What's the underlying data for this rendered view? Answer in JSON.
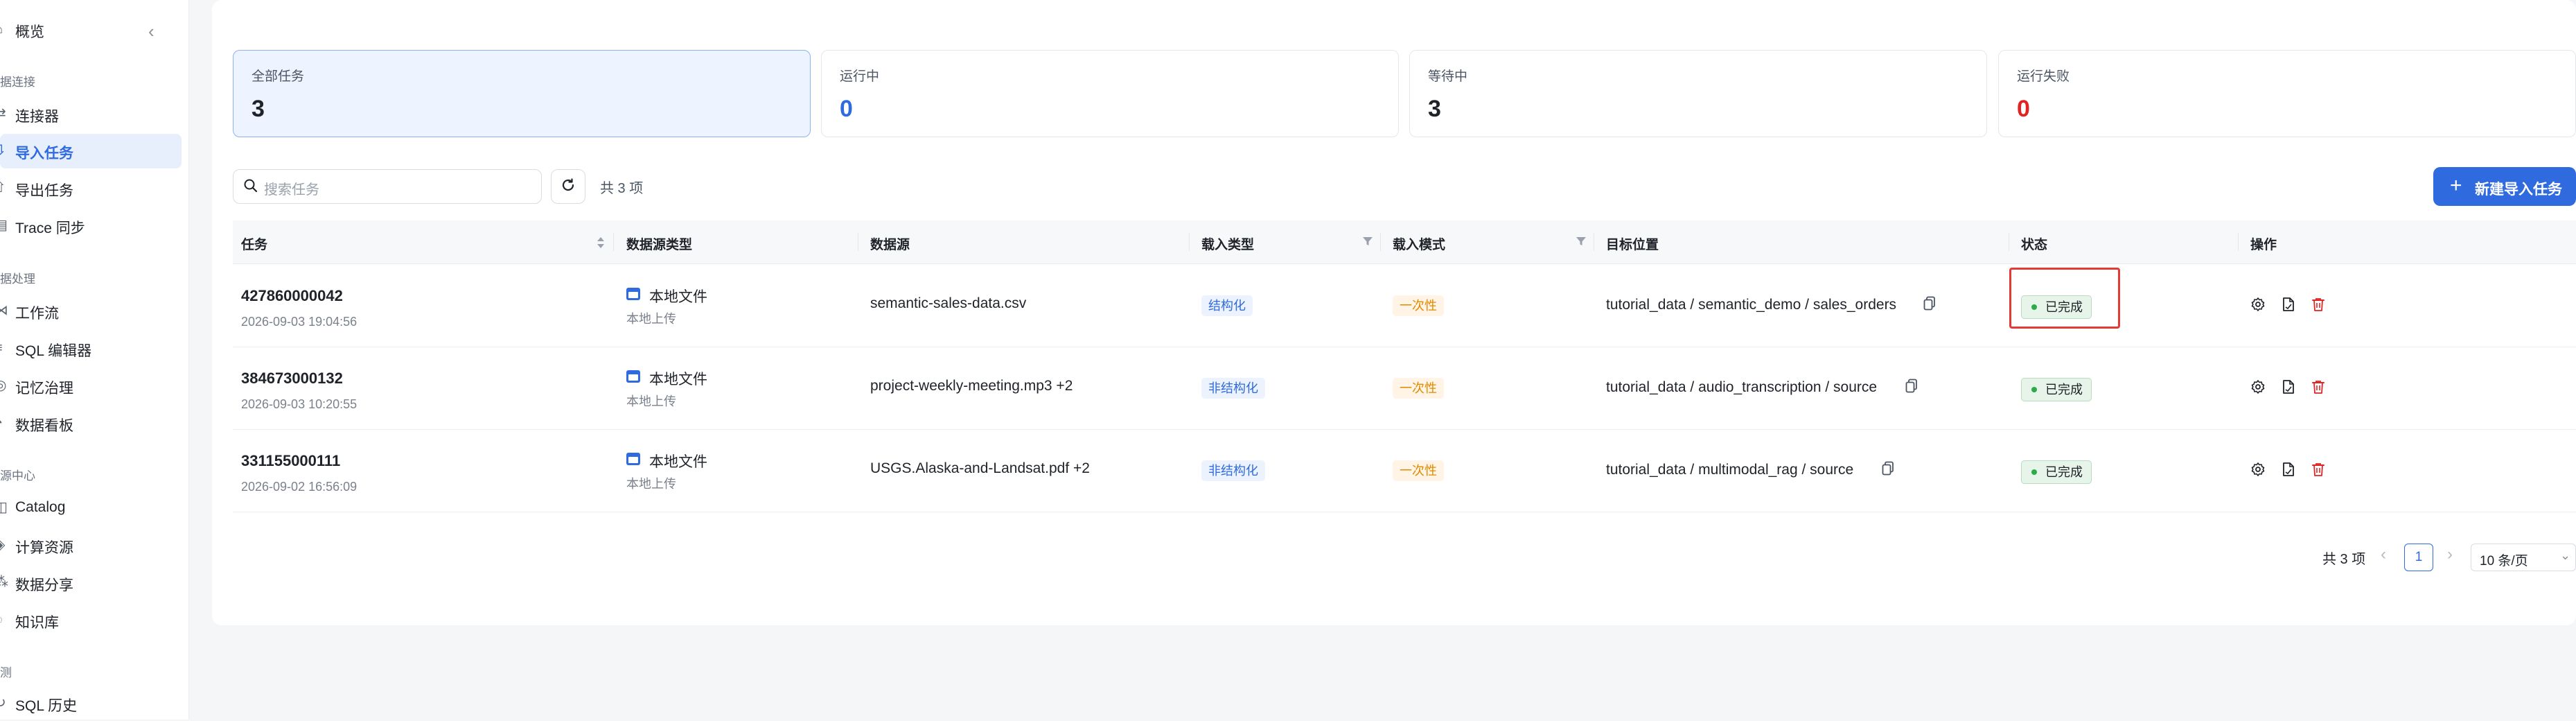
{
  "sidebar": {
    "overview": "概览",
    "groups": [
      "据连接",
      "据处理",
      "源中心",
      "测"
    ],
    "items": [
      {
        "label": "连接器",
        "icon": "connector-icon"
      },
      {
        "label": "导入任务",
        "icon": "import-icon",
        "active": true
      },
      {
        "label": "导出任务",
        "icon": "export-icon"
      },
      {
        "label": "Trace 同步",
        "icon": "trace-icon"
      },
      {
        "label": "工作流",
        "icon": "workflow-icon"
      },
      {
        "label": "SQL 编辑器",
        "icon": "sql-editor-icon"
      },
      {
        "label": "记忆治理",
        "icon": "memory-icon"
      },
      {
        "label": "数据看板",
        "icon": "dashboard-icon"
      },
      {
        "label": "Catalog",
        "icon": "catalog-icon"
      },
      {
        "label": "计算资源",
        "icon": "compute-icon"
      },
      {
        "label": "数据分享",
        "icon": "share-icon"
      },
      {
        "label": "知识库",
        "icon": "knowledge-icon"
      },
      {
        "label": "SQL 历史",
        "icon": "history-icon"
      }
    ]
  },
  "stats": [
    {
      "label": "全部任务",
      "value": "3",
      "color": "#1f2329"
    },
    {
      "label": "运行中",
      "value": "0",
      "color": "#2f6bdf"
    },
    {
      "label": "等待中",
      "value": "3",
      "color": "#1f2329"
    },
    {
      "label": "运行失败",
      "value": "0",
      "color": "#e02424"
    }
  ],
  "toolbar": {
    "search_placeholder": "搜索任务",
    "count_text": "共 3 项",
    "new_button": "新建导入任务"
  },
  "table": {
    "headers": [
      "任务",
      "数据源类型",
      "数据源",
      "载入类型",
      "载入模式",
      "目标位置",
      "状态",
      "操作"
    ],
    "rows": [
      {
        "id": "427860000042",
        "time": "2026-09-03 19:04:56",
        "src_type": "本地文件",
        "src_sub": "本地上传",
        "datasource": "semantic-sales-data.csv",
        "load_type": "结构化",
        "load_mode": "一次性",
        "target": "tutorial_data / semantic_demo / sales_orders",
        "status": "已完成"
      },
      {
        "id": "384673000132",
        "time": "2026-09-03 10:20:55",
        "src_type": "本地文件",
        "src_sub": "本地上传",
        "datasource": "project-weekly-meeting.mp3 +2",
        "load_type": "非结构化",
        "load_mode": "一次性",
        "target": "tutorial_data / audio_transcription / source",
        "status": "已完成"
      },
      {
        "id": "331155000111",
        "time": "2026-09-02 16:56:09",
        "src_type": "本地文件",
        "src_sub": "本地上传",
        "datasource": "USGS.Alaska-and-Landsat.pdf +2",
        "load_type": "非结构化",
        "load_mode": "一次性",
        "target": "tutorial_data / multimodal_rag / source",
        "status": "已完成"
      }
    ]
  },
  "pagination": {
    "total": "共 3 项",
    "current": "1",
    "page_size": "10 条/页"
  }
}
